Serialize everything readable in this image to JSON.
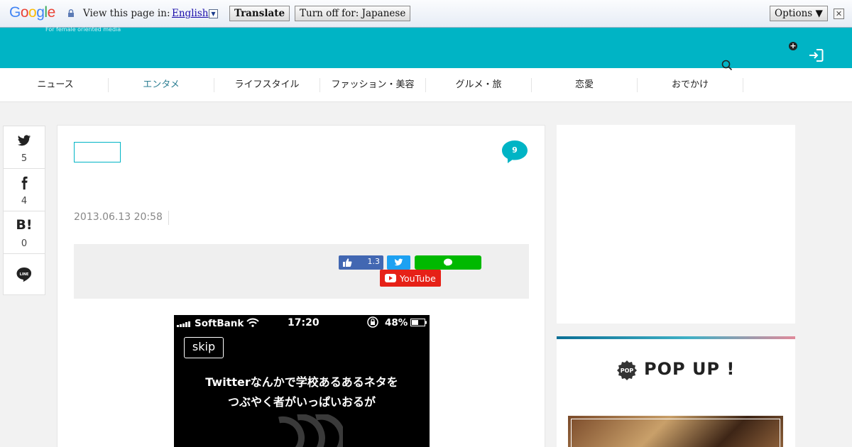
{
  "translate_bar": {
    "logo_text": "Google",
    "logo_colors": [
      "#4285f4",
      "#ea4335",
      "#fbbc05",
      "#4285f4",
      "#34a853",
      "#ea4335"
    ],
    "view_label": "View this page in:",
    "language": "English",
    "translate_button": "Translate",
    "turn_off_button": "Turn off for: Japanese",
    "options_button": "Options ▼",
    "close_glyph": "✕"
  },
  "header": {
    "tagline": "For female oriented media",
    "plus_glyph": "+",
    "accent_color": "#00b4c5"
  },
  "nav": {
    "items": [
      {
        "label": "ニュース"
      },
      {
        "label": "エンタメ"
      },
      {
        "label": "ライフスタイル"
      },
      {
        "label": "ファッション・美容"
      },
      {
        "label": "グルメ・旅"
      },
      {
        "label": "恋愛"
      },
      {
        "label": "おでかけ"
      }
    ],
    "active_index": 1
  },
  "social": {
    "twitter_count": "5",
    "facebook_count": "4",
    "hatena_label": "B!",
    "hatena_count": "0",
    "line_label": "LINE"
  },
  "article": {
    "comment_count": "9",
    "date": "2013.06.13 20:58",
    "share": {
      "fb_like_count": "1.3",
      "youtube_label": "YouTube"
    },
    "phone": {
      "carrier": "SoftBank",
      "time": "17:20",
      "battery": "48%",
      "skip_label": "skip",
      "caption_line1": "Twitterなんかで学校あるあるネタを",
      "caption_line2": "つぶやく者がいっぱいおるが"
    }
  },
  "sidebar": {
    "popup_title": "POP UP !",
    "popup_badge": "POP"
  }
}
